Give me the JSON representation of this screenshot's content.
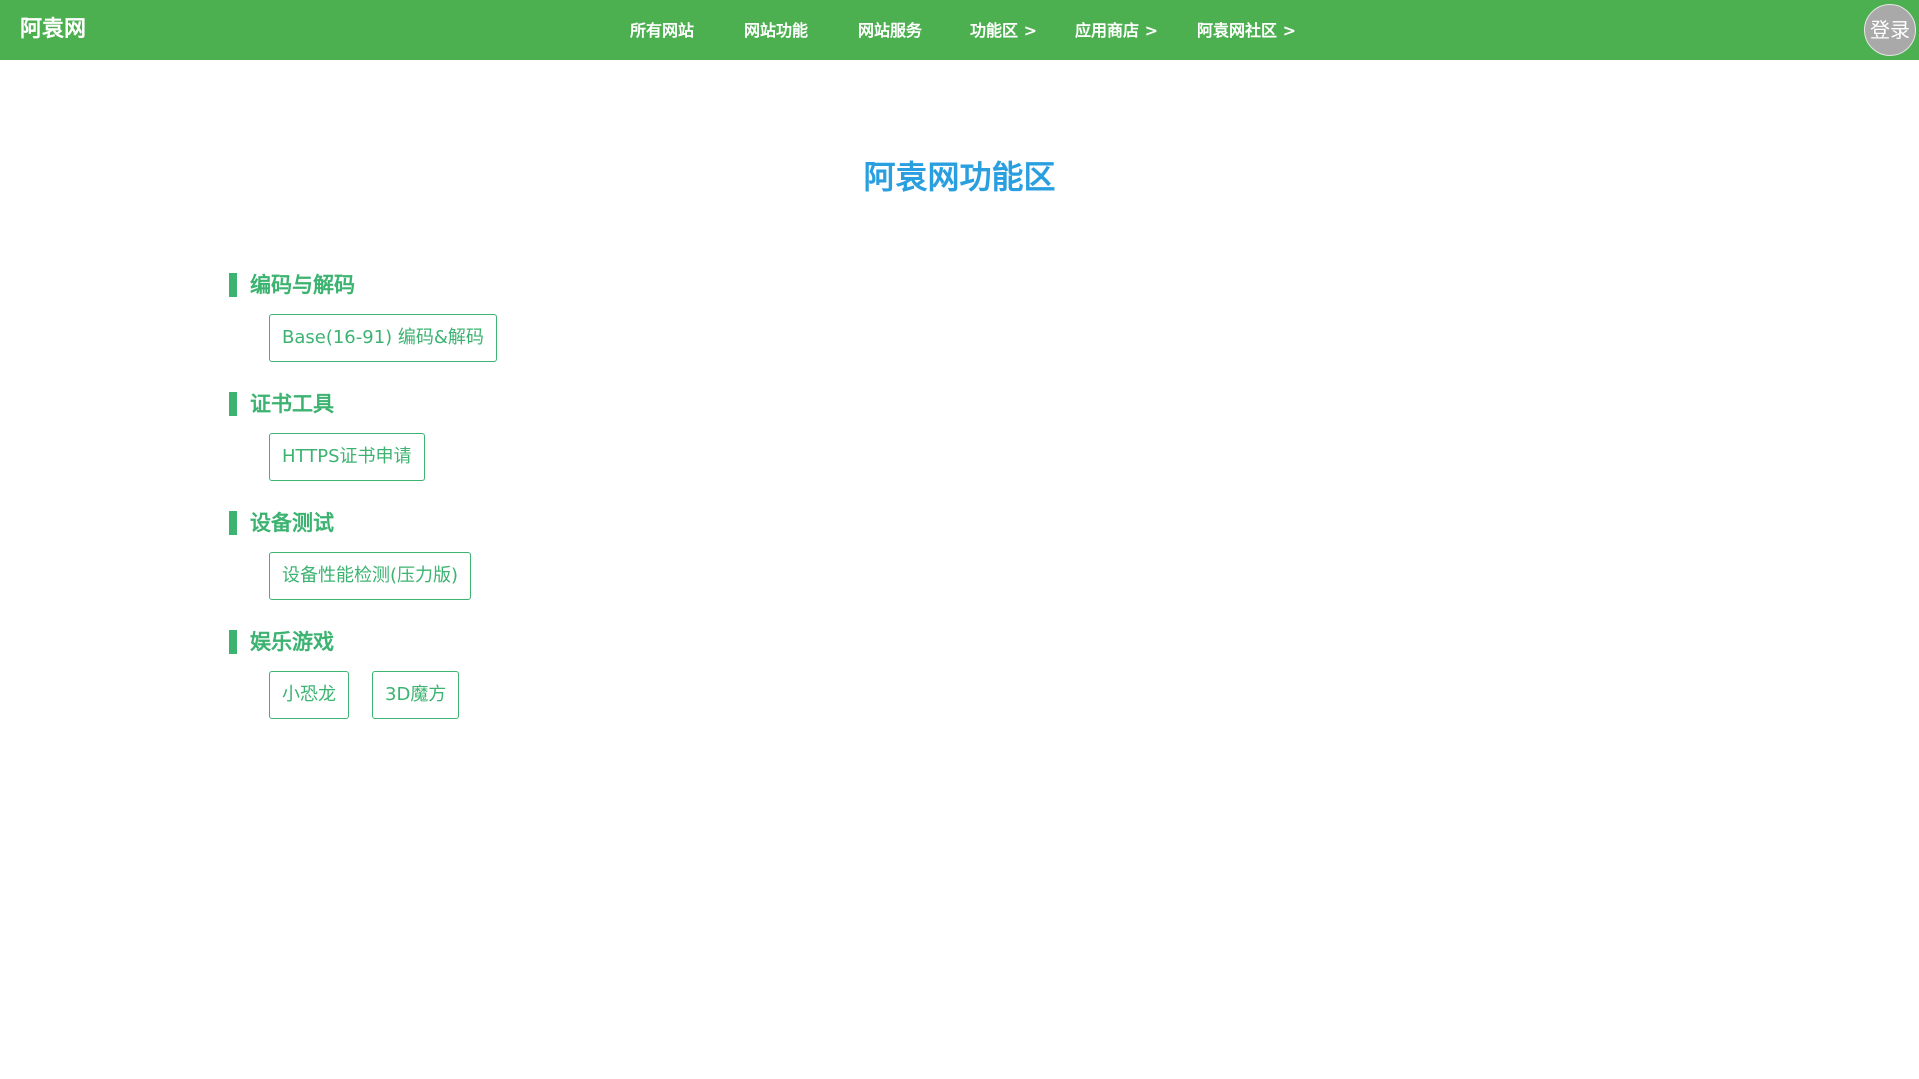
{
  "header": {
    "logo": "阿袁网",
    "nav": [
      {
        "label": "所有网站"
      },
      {
        "label": "网站功能"
      },
      {
        "label": "网站服务"
      },
      {
        "label": "功能区 >"
      },
      {
        "label": "应用商店 >"
      },
      {
        "label": "阿袁网社区 >"
      }
    ],
    "login_label": "登录"
  },
  "main": {
    "title": "阿袁网功能区",
    "sections": [
      {
        "title": "编码与解码",
        "items": [
          {
            "label": "Base(16-91) 编码&解码"
          }
        ]
      },
      {
        "title": "证书工具",
        "items": [
          {
            "label": "HTTPS证书申请"
          }
        ]
      },
      {
        "title": "设备测试",
        "items": [
          {
            "label": "设备性能检测(压力版)"
          }
        ]
      },
      {
        "title": "娱乐游戏",
        "items": [
          {
            "label": "小恐龙"
          },
          {
            "label": "3D魔方"
          }
        ]
      }
    ]
  },
  "colors": {
    "header_bg": "#4caf50",
    "title": "#2a9fe0",
    "accent": "#3cb371",
    "login_bg": "#a9a9a9"
  }
}
